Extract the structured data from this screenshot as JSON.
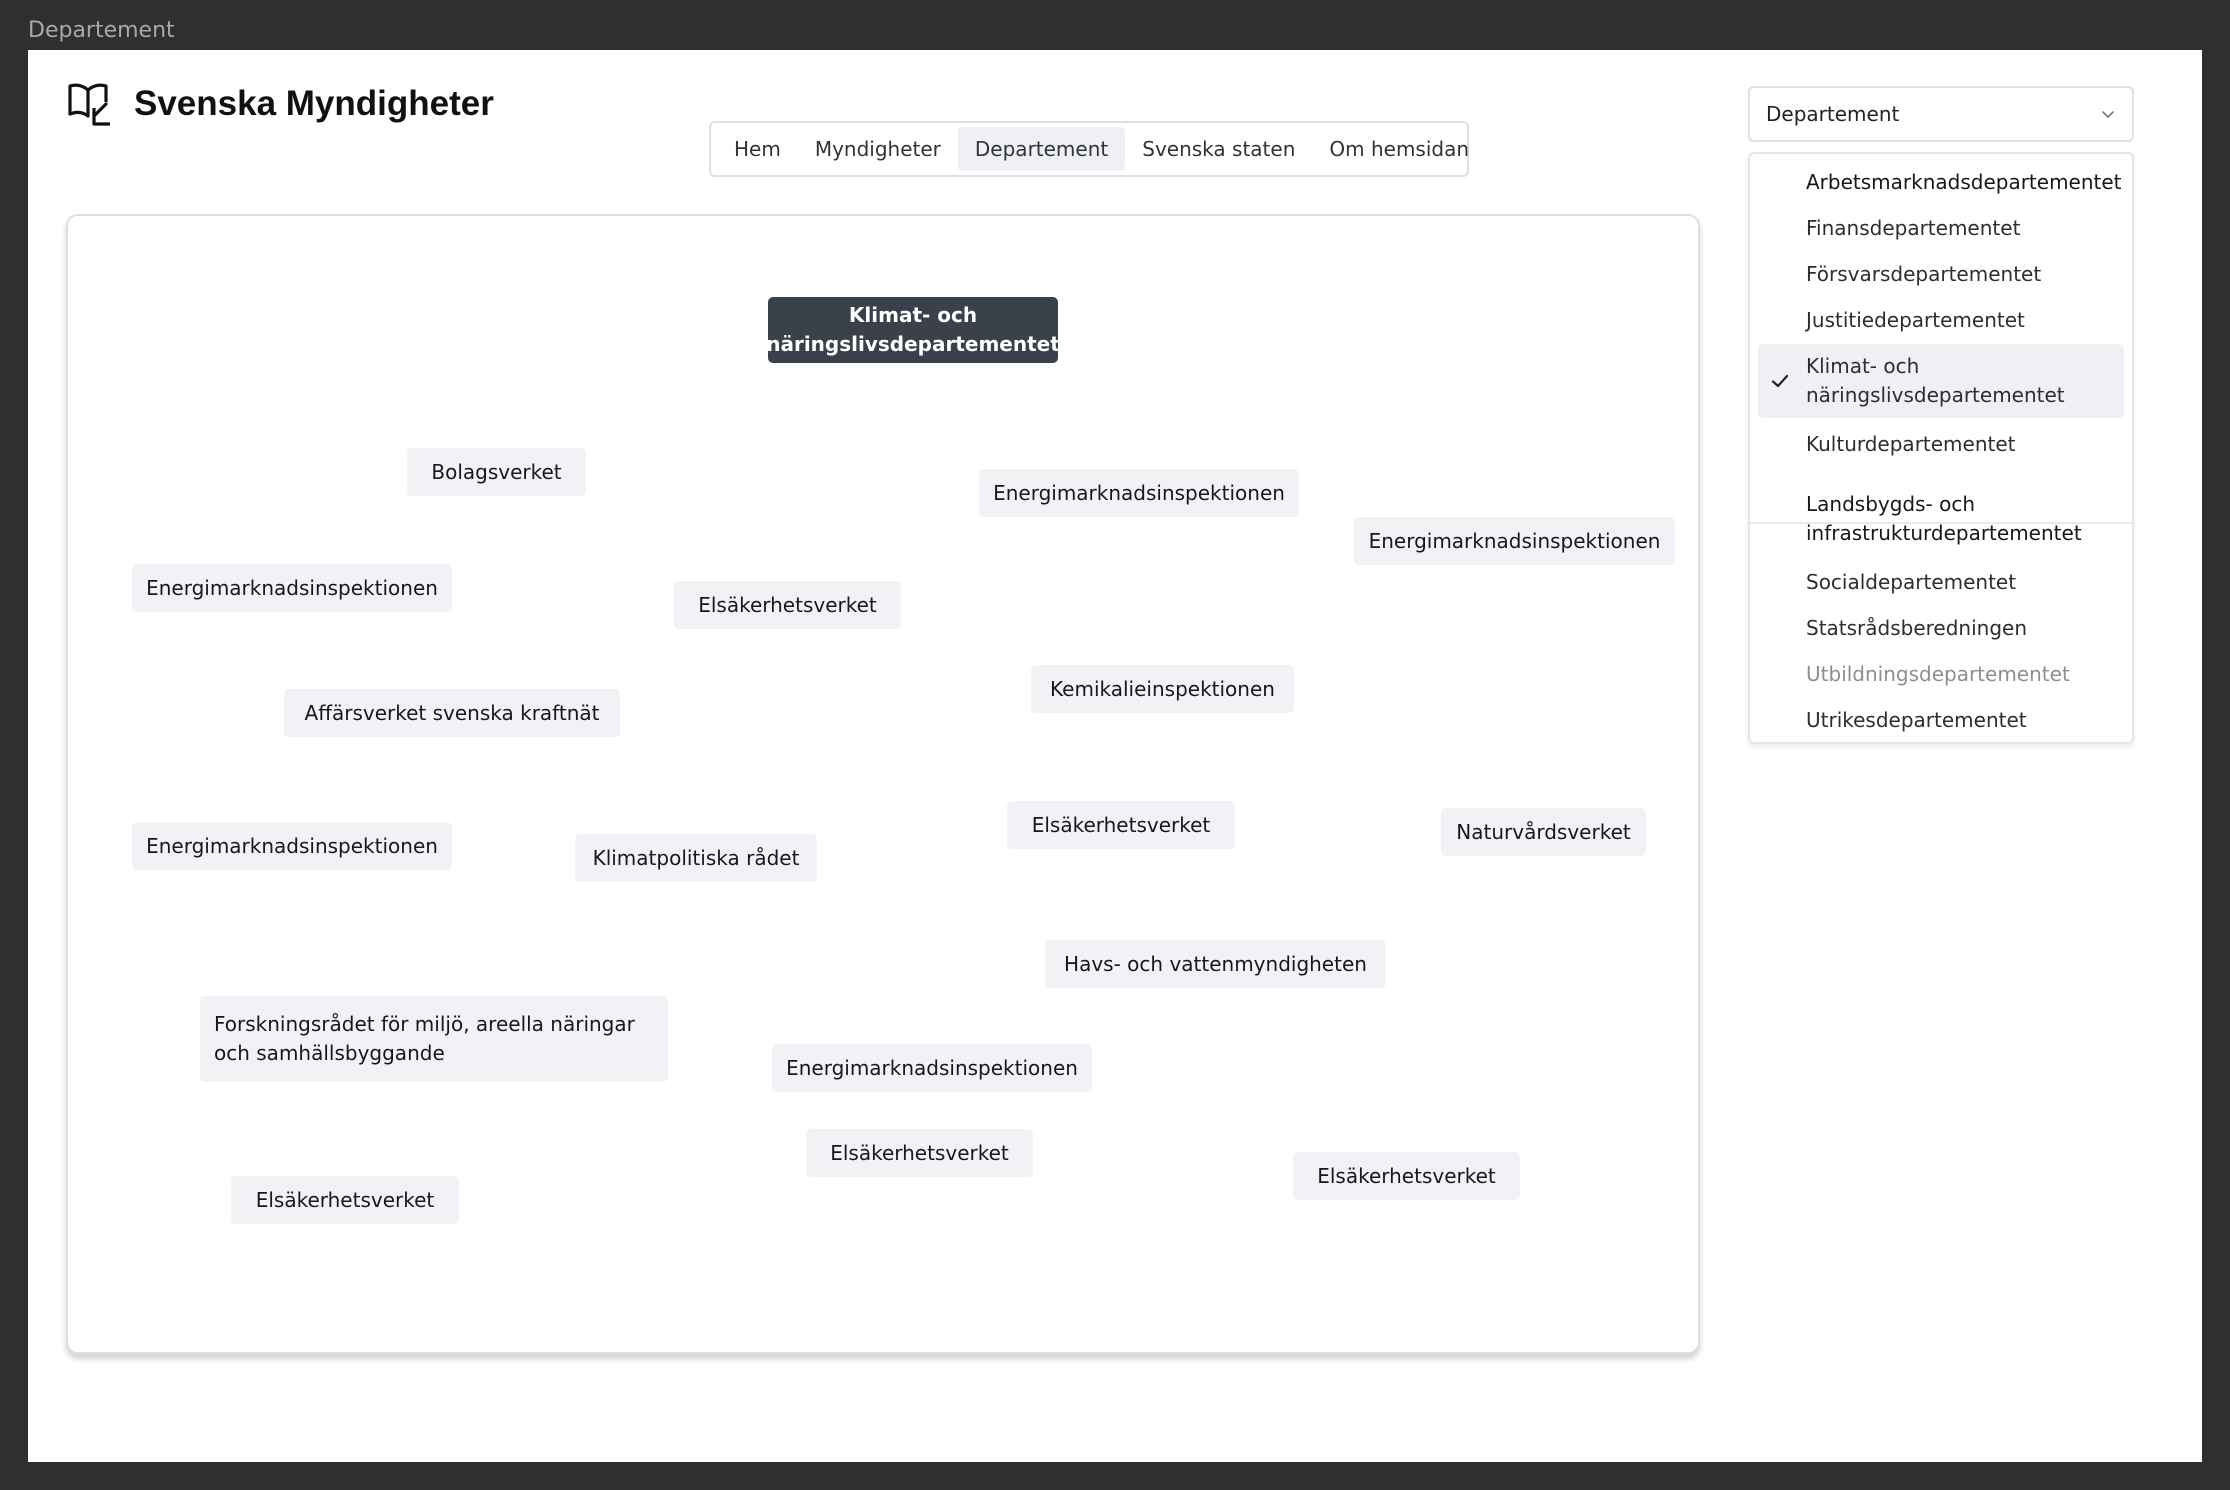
{
  "window": {
    "title": "Departement"
  },
  "brand": {
    "title": "Svenska Myndigheter",
    "icon": "book-icon"
  },
  "nav": {
    "items": [
      {
        "label": "Hem",
        "active": false
      },
      {
        "label": "Myndigheter",
        "active": false
      },
      {
        "label": "Departement",
        "active": true
      },
      {
        "label": "Svenska staten",
        "active": false
      },
      {
        "label": "Om hemsidan",
        "active": false
      }
    ]
  },
  "select": {
    "value": "Departement",
    "icon": "chevron-down-icon"
  },
  "dropdown": {
    "options": [
      {
        "label": "Arbetsmarknadsdepartementet",
        "selected": false
      },
      {
        "label": "Finansdepartementet",
        "selected": false
      },
      {
        "label": "Försvarsdepartementet",
        "selected": false
      },
      {
        "label": "Justitiedepartementet",
        "selected": false
      },
      {
        "label": "Klimat- och näringslivsdepartementet",
        "selected": true
      },
      {
        "label": "Kulturdepartementet",
        "selected": false
      },
      {
        "label": "Landsbygds- och infrastrukturdepartementet",
        "selected": false
      },
      {
        "label": "Socialdepartementet",
        "selected": false
      },
      {
        "label": "Statsrådsberedningen",
        "selected": false
      },
      {
        "label": "Utbildningsdepartementet",
        "selected": false
      },
      {
        "label": "Utrikesdepartementet",
        "selected": false
      }
    ]
  },
  "graph": {
    "center": "Klimat- och näringslivsdepartementet",
    "nodes": [
      "Bolagsverket",
      "Energimarknadsinspektionen",
      "Energimarknadsinspektionen",
      "Energimarknadsinspektionen",
      "Elsäkerhetsverket",
      "Affärsverket svenska kraftnät",
      "Kemikalieinspektionen",
      "Energimarknadsinspektionen",
      "Klimatpolitiska rådet",
      "Elsäkerhetsverket",
      "Naturvårdsverket",
      "Havs- och vattenmyndigheten",
      "Forskningsrådet för miljö, areella näringar och samhällsbyggande",
      "Energimarknadsinspektionen",
      "Elsäkerhetsverket",
      "Elsäkerhetsverket",
      "Elsäkerhetsverket"
    ]
  }
}
